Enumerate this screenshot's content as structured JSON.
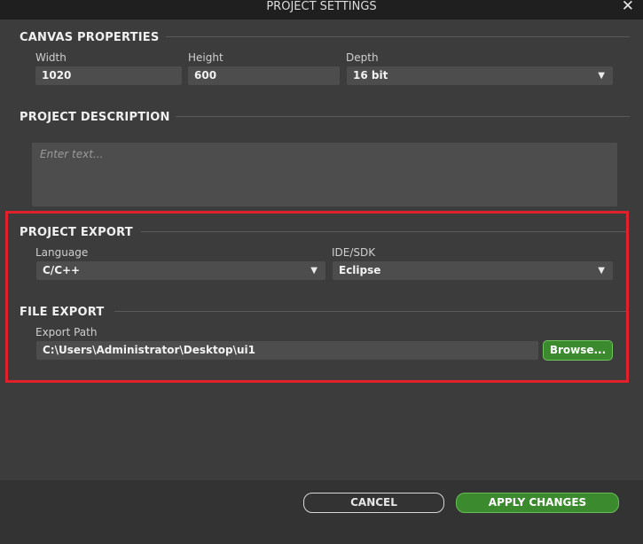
{
  "window": {
    "title": "PROJECT SETTINGS",
    "close_glyph": "✕"
  },
  "canvas": {
    "title": "CANVAS PROPERTIES",
    "width_label": "Width",
    "width_value": "1020",
    "height_label": "Height",
    "height_value": "600",
    "depth_label": "Depth",
    "depth_value": "16 bit"
  },
  "description": {
    "title": "PROJECT DESCRIPTION",
    "placeholder": "Enter text..."
  },
  "export": {
    "title": "PROJECT EXPORT",
    "language_label": "Language",
    "language_value": "C/C++",
    "ide_label": "IDE/SDK",
    "ide_value": "Eclipse"
  },
  "file_export": {
    "title": "FILE EXPORT",
    "path_label": "Export Path",
    "path_value": "C:\\Users\\Administrator\\Desktop\\ui1",
    "browse_label": "Browse..."
  },
  "footer": {
    "cancel_label": "CANCEL",
    "apply_label": "APPLY CHANGES"
  },
  "colors": {
    "accent_green": "#3b8a2e",
    "highlight_red": "#e0202a",
    "background": "#3c3c3c"
  },
  "icons": {
    "dropdown": "▼"
  }
}
